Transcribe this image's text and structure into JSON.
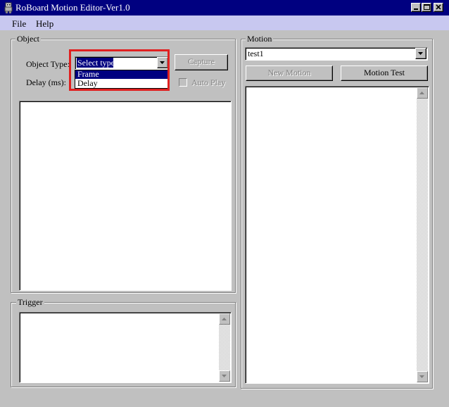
{
  "window": {
    "title": "RoBoard Motion Editor-Ver1.0"
  },
  "menu": {
    "items": [
      "File",
      "Help"
    ]
  },
  "object": {
    "group_label": "Object",
    "type_label": "Object Type:",
    "delay_label": "Delay (ms):",
    "type_selected": "Select type",
    "type_options": [
      "Frame",
      "Delay"
    ],
    "capture_label": "Capture",
    "autoplay_label": "Auto Play"
  },
  "trigger": {
    "group_label": "Trigger"
  },
  "motion": {
    "group_label": "Motion",
    "selected": "test1",
    "new_motion_label": "New Motion",
    "motion_test_label": "Motion Test"
  },
  "colors": {
    "titlebar": "#000080",
    "menubar": "#c8c8f0",
    "face": "#c0c0c0",
    "highlight_outline": "#e02020",
    "selection": "#000080"
  }
}
